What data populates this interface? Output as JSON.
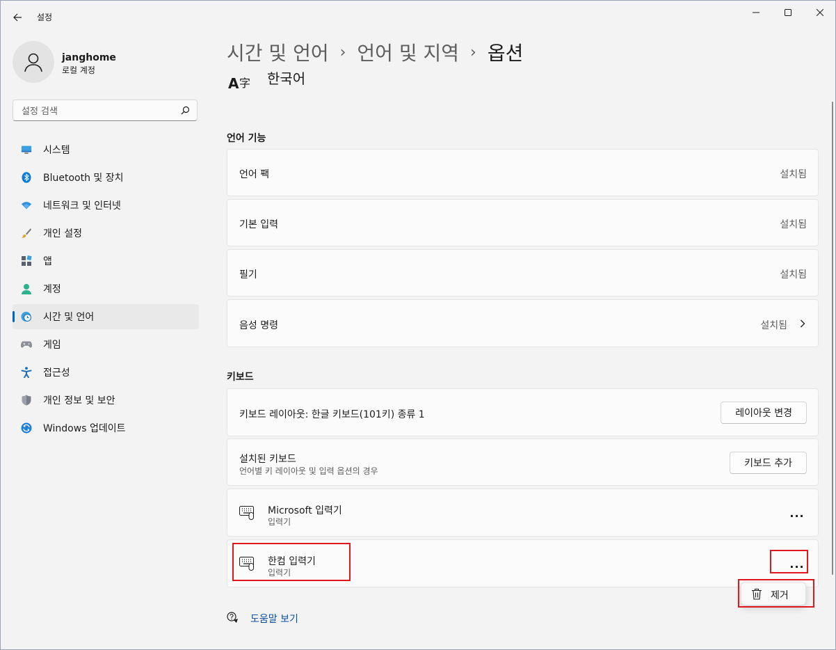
{
  "window": {
    "title": "설정",
    "controls": [
      "minimize",
      "maximize",
      "close"
    ]
  },
  "user": {
    "name": "janghome",
    "account_type": "로컬 계정"
  },
  "search": {
    "placeholder": "설정 검색"
  },
  "sidebar": {
    "items": [
      {
        "label": "시스템",
        "icon": "monitor-icon"
      },
      {
        "label": "Bluetooth 및 장치",
        "icon": "bluetooth-icon"
      },
      {
        "label": "네트워크 및 인터넷",
        "icon": "wifi-icon"
      },
      {
        "label": "개인 설정",
        "icon": "brush-icon"
      },
      {
        "label": "앱",
        "icon": "apps-icon"
      },
      {
        "label": "계정",
        "icon": "person-icon"
      },
      {
        "label": "시간 및 언어",
        "icon": "globe-clock-icon",
        "active": true
      },
      {
        "label": "게임",
        "icon": "gamepad-icon"
      },
      {
        "label": "접근성",
        "icon": "accessibility-icon"
      },
      {
        "label": "개인 정보 및 보안",
        "icon": "shield-icon"
      },
      {
        "label": "Windows 업데이트",
        "icon": "update-icon"
      }
    ]
  },
  "breadcrumb": {
    "items": [
      "시간 및 언어",
      "언어 및 지역",
      "옵션"
    ],
    "separator": "›"
  },
  "language": {
    "name": "한국어"
  },
  "language_features": {
    "title": "언어 기능",
    "rows": [
      {
        "label": "언어 팩",
        "status": "설치됨"
      },
      {
        "label": "기본 입력",
        "status": "설치됨"
      },
      {
        "label": "필기",
        "status": "설치됨"
      },
      {
        "label": "음성 명령",
        "status": "설치됨"
      }
    ]
  },
  "keyboard": {
    "title": "키보드",
    "layout_label": "키보드 레이아웃: 한글 키보드(101키) 종류 1",
    "layout_button": "레이아웃 변경",
    "installed_label": "설치된 키보드",
    "installed_sub": "언어별 키 레이아웃 및 입력 옵션의 경우",
    "add_button": "키보드 추가",
    "imes": [
      {
        "name": "Microsoft 입력기",
        "type": "입력기"
      },
      {
        "name": "한컴 입력기",
        "type": "입력기"
      }
    ],
    "more_label": "..."
  },
  "popup": {
    "remove_label": "제거"
  },
  "help": {
    "label": "도움말 보기"
  },
  "colors": {
    "accent": "#0067c0",
    "annotation": "#e0171e"
  }
}
